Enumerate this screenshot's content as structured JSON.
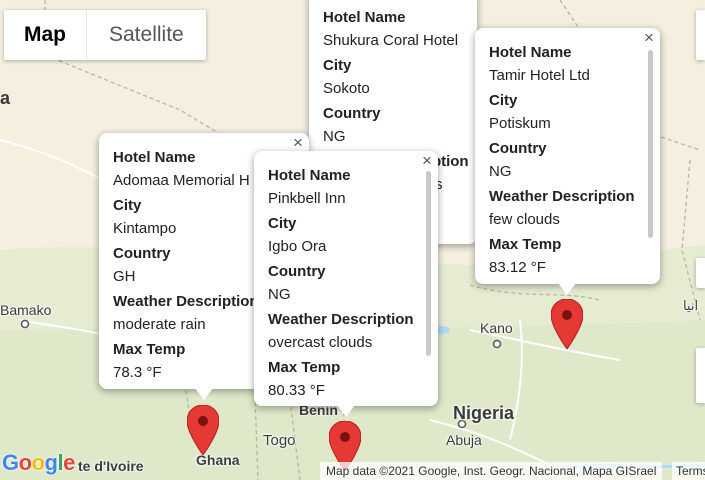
{
  "map_type": {
    "map_label": "Map",
    "satellite_label": "Satellite",
    "active": "Map"
  },
  "colors": {
    "land": "#f5efe0",
    "land_green": "#dfe8c9",
    "marker": "#e53935",
    "marker_dot": "#7a1212"
  },
  "field_labels": {
    "hotel": "Hotel Name",
    "city": "City",
    "country": "Country",
    "weather": "Weather Description",
    "temp": "Max Temp"
  },
  "info_windows": [
    {
      "hotel": "Shukura Coral Hotel",
      "city": "Sokoto",
      "country": "NG",
      "weather": "",
      "temp": ""
    },
    {
      "hotel": "Adomaa Memorial H",
      "city": "Kintampo",
      "country": "GH",
      "weather": "moderate rain",
      "temp": "78.3 °F"
    },
    {
      "hotel": "Pinkbell Inn",
      "city": "Igbo Ora",
      "country": "NG",
      "weather": "overcast clouds",
      "temp": "80.33 °F"
    },
    {
      "hotel": "Tamir Hotel Ltd",
      "city": "Potiskum",
      "country": "NG",
      "weather": "few clouds",
      "temp": "83.12 °F"
    }
  ],
  "partial_values": {
    "sokoto_weather_tail": "s"
  },
  "place_labels": {
    "a_edge": "a",
    "bamako": "Bamako",
    "kano": "Kano",
    "nigeria": "Nigeria",
    "abuja": "Abuja",
    "benin": "Benin",
    "togo": "Togo",
    "ghana": "Ghana",
    "cote_divoire": "te d'Ivoire",
    "arabic_edge": "انيا"
  },
  "close_glyph": "×",
  "attribution": "Map data ©2021 Google, Inst. Geogr. Nacional, Mapa GISrael",
  "terms": "Terms",
  "google_logo": {
    "g1": "G",
    "o1": "o",
    "o2": "o",
    "g2": "g",
    "l": "l",
    "e": "e"
  }
}
